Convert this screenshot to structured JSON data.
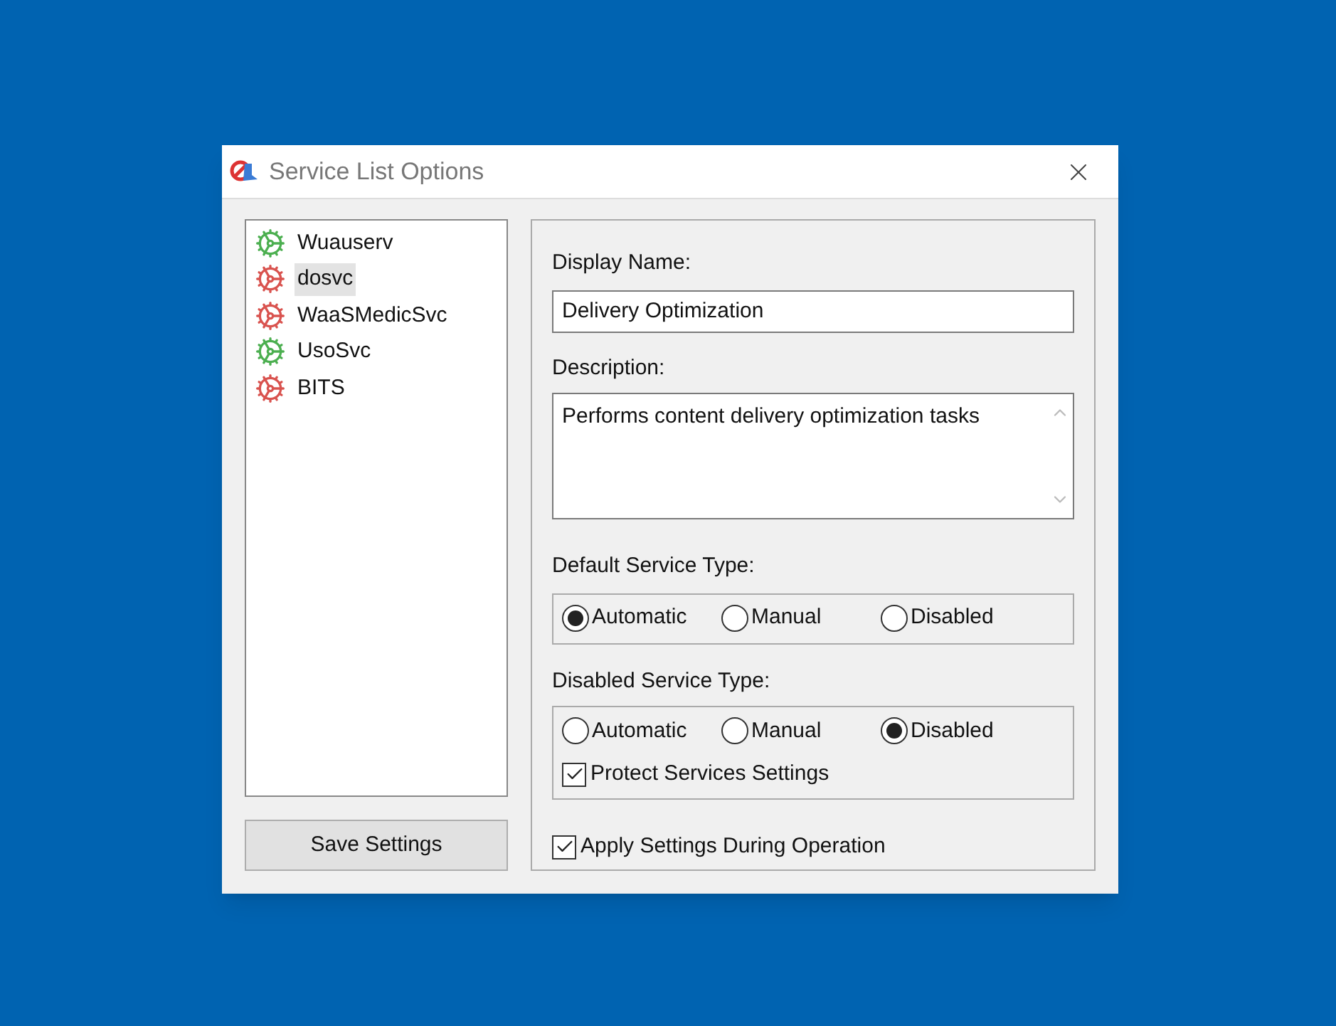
{
  "window": {
    "title": "Service List Options"
  },
  "services": [
    {
      "name": "Wuauserv",
      "color": "#4caf50",
      "selected": false
    },
    {
      "name": "dosvc",
      "color": "#d9534f",
      "selected": true
    },
    {
      "name": "WaaSMedicSvc",
      "color": "#d9534f",
      "selected": false
    },
    {
      "name": "UsoSvc",
      "color": "#4caf50",
      "selected": false
    },
    {
      "name": "BITS",
      "color": "#d9534f",
      "selected": false
    }
  ],
  "save_button": "Save Settings",
  "display_name": {
    "label": "Display Name:",
    "value": "Delivery Optimization"
  },
  "description": {
    "label": "Description:",
    "value": "Performs content delivery optimization tasks"
  },
  "default_service_type": {
    "label": "Default Service Type:",
    "options": [
      {
        "label": "Automatic",
        "selected": true
      },
      {
        "label": "Manual",
        "selected": false
      },
      {
        "label": "Disabled",
        "selected": false
      }
    ]
  },
  "disabled_service_type": {
    "label": "Disabled Service Type:",
    "options": [
      {
        "label": "Automatic",
        "selected": false
      },
      {
        "label": "Manual",
        "selected": false
      },
      {
        "label": "Disabled",
        "selected": true
      }
    ],
    "protect": {
      "label": "Protect Services Settings",
      "checked": true
    }
  },
  "apply_during_operation": {
    "label": "Apply Settings During Operation",
    "checked": true
  }
}
